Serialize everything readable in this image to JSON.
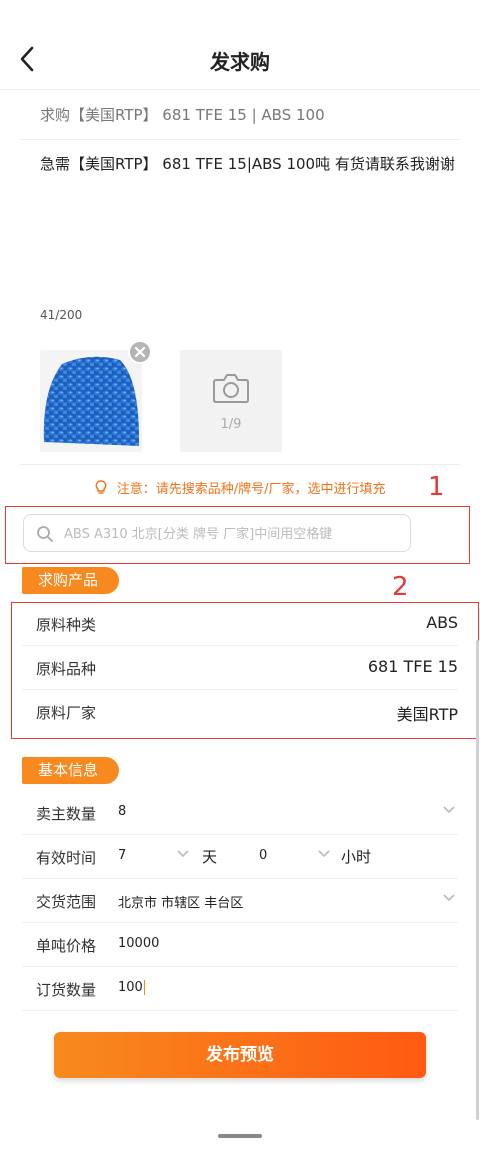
{
  "header": {
    "title": "发求购"
  },
  "purchase": {
    "title_line": "求购【美国RTP】 681 TFE 15 | ABS 100",
    "description": "急需【美国RTP】 681 TFE 15|ABS  100吨   有货请联系我谢谢",
    "char_count": "41/200",
    "photo_counter": "1/9"
  },
  "notice": {
    "text": "注意：请先搜索品种/牌号/厂家，选中进行填充"
  },
  "annotations": {
    "marker1": "1",
    "marker2": "2",
    "color": "#e53935"
  },
  "search": {
    "placeholder": "ABS A310 北京[分类 牌号 厂家]中间用空格键",
    "value": ""
  },
  "product_section": {
    "tag": "求购产品",
    "rows": [
      {
        "label": "原料种类",
        "value": "ABS"
      },
      {
        "label": "原料品种",
        "value": "681 TFE 15"
      },
      {
        "label": "原料厂家",
        "value": "美国RTP"
      }
    ]
  },
  "basic_section": {
    "tag": "基本信息",
    "seller_count": {
      "label": "卖主数量",
      "value": "8"
    },
    "validity": {
      "label": "有效时间",
      "days": "7",
      "days_unit": "天",
      "hours": "0",
      "hours_unit": "小时"
    },
    "delivery_area": {
      "label": "交货范围",
      "value": "北京市 市辖区 丰台区"
    },
    "unit_price": {
      "label": "单吨价格",
      "value": "10000"
    },
    "order_qty": {
      "label": "订货数量",
      "value": "100"
    }
  },
  "actions": {
    "publish_label": "发布预览"
  },
  "colors": {
    "accent": "#f7891f",
    "button_end": "#ff5a12",
    "notice": "#f0731a"
  }
}
